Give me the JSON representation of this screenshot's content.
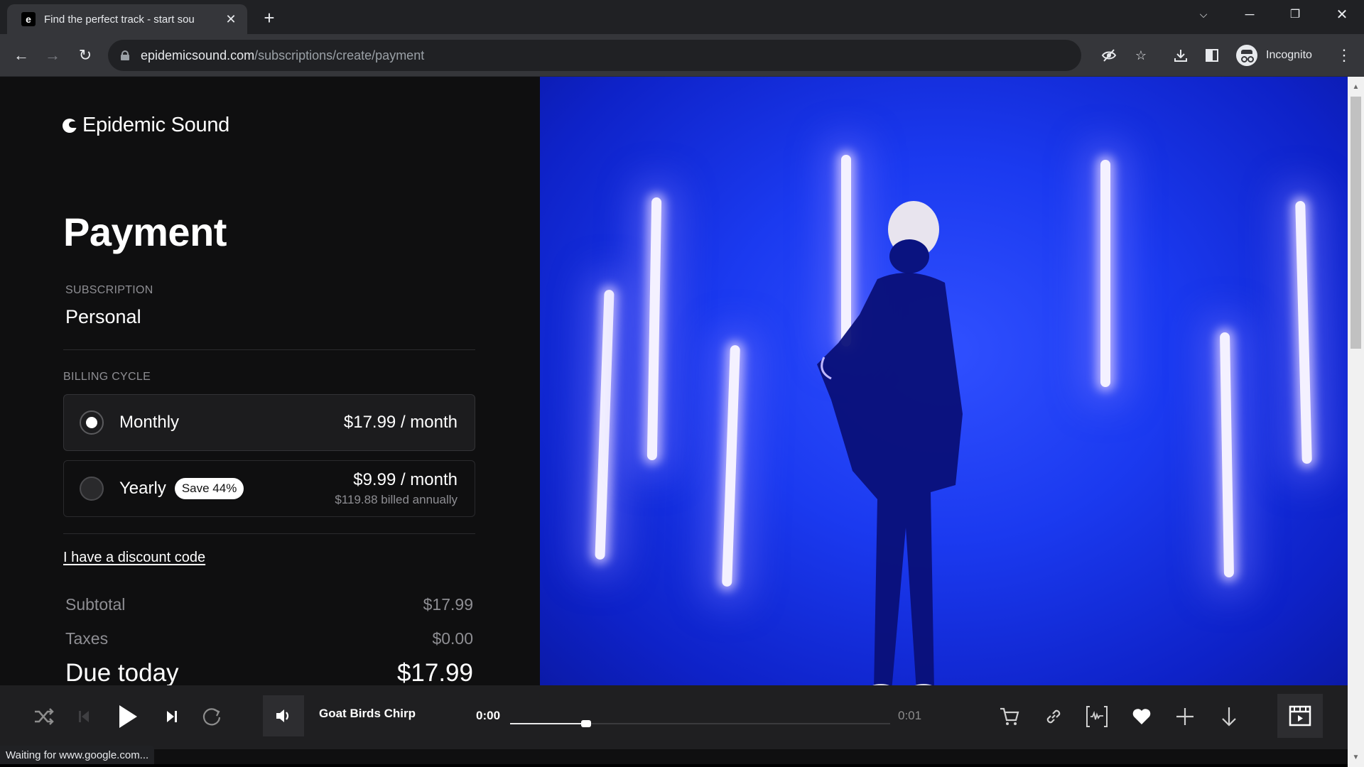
{
  "browser": {
    "tab": {
      "title": "Find the perfect track - start sou",
      "favicon": "epidemic-sound-favicon"
    },
    "url": {
      "host": "epidemicsound.com",
      "path": "/subscriptions/create/payment"
    },
    "profile_label": "Incognito",
    "status_text": "Waiting for www.google.com..."
  },
  "page": {
    "brand": "Epidemic Sound",
    "title": "Payment",
    "subscription": {
      "label": "SUBSCRIPTION",
      "value": "Personal"
    },
    "billing": {
      "label": "BILLING CYCLE",
      "options": [
        {
          "name": "Monthly",
          "price": "$17.99 / month",
          "selected": true
        },
        {
          "name": "Yearly",
          "badge": "Save 44%",
          "price": "$9.99 / month",
          "note": "$119.88 billed annually",
          "selected": false
        }
      ]
    },
    "discount_link": "I have a discount code",
    "summary": {
      "subtotal": {
        "label": "Subtotal",
        "value": "$17.99"
      },
      "taxes": {
        "label": "Taxes",
        "value": "$0.00"
      },
      "total": {
        "label": "Due today",
        "value": "$17.99"
      }
    },
    "hero_colors": {
      "background": "#1b3af0",
      "light": "#f4f1ff"
    }
  },
  "player": {
    "track_title": "Goat Birds Chirp",
    "elapsed": "0:00",
    "duration": "0:01",
    "progress_fraction": 0.2,
    "controls": [
      "shuffle",
      "previous",
      "play",
      "next",
      "repeat",
      "volume"
    ],
    "actions": [
      "cart",
      "link",
      "waveform-stems",
      "favorite",
      "add",
      "download",
      "video-preview"
    ]
  }
}
